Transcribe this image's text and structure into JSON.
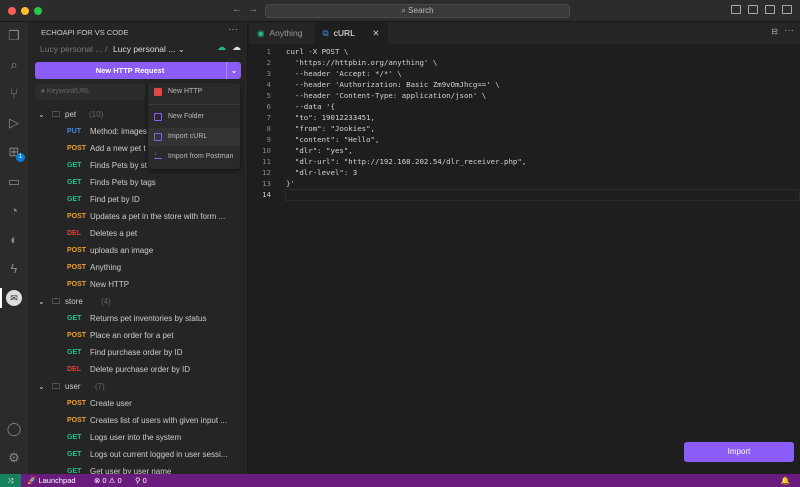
{
  "titlebar": {
    "search": "Search"
  },
  "sidebar": {
    "title": "ECHOAPI FOR VS CODE",
    "workspace": "Lucy personal ...",
    "project": "Lucy personal ...",
    "new_request": "New HTTP Request",
    "search_placeholder": "Keyword/URL",
    "folders": [
      {
        "name": "pet",
        "count": "(10)",
        "items": [
          [
            "PUT",
            "Method: images"
          ],
          [
            "POST",
            "Add a new pet t"
          ],
          [
            "GET",
            "Finds Pets by st"
          ],
          [
            "GET",
            "Finds Pets by tags"
          ],
          [
            "GET",
            "Find pet by ID"
          ],
          [
            "POST",
            "Updates a pet in the store with form ..."
          ],
          [
            "DEL",
            "Deletes a pet"
          ],
          [
            "POST",
            "uploads an image"
          ],
          [
            "POST",
            "Anything"
          ],
          [
            "POST",
            "New HTTP"
          ]
        ]
      },
      {
        "name": "store",
        "count": "(4)",
        "items": [
          [
            "GET",
            "Returns pet inventories by status"
          ],
          [
            "POST",
            "Place an order for a pet"
          ],
          [
            "GET",
            "Find purchase order by ID"
          ],
          [
            "DEL",
            "Delete purchase order by ID"
          ]
        ]
      },
      {
        "name": "user",
        "count": "(7)",
        "items": [
          [
            "POST",
            "Create user"
          ],
          [
            "POST",
            "Creates list of users with given input ..."
          ],
          [
            "GET",
            "Logs user into the system"
          ],
          [
            "GET",
            "Logs out current logged in user sessi..."
          ],
          [
            "GET",
            "Get user by user name"
          ]
        ]
      }
    ]
  },
  "menu": {
    "items": [
      "New HTTP",
      "New Folder",
      "Import cURL",
      "Import from Postman"
    ]
  },
  "tabs": [
    {
      "label": "Anything"
    },
    {
      "label": "cURL"
    }
  ],
  "code": [
    "curl -X POST \\",
    "  'https://httpbin.org/anything' \\",
    "  --header 'Accept: */*' \\",
    "  --header 'Authorization: Basic Zm9vOmJhcg==' \\",
    "  --header 'Content-Type: application/json' \\",
    "  --data '{",
    "  \"to\": 19012233451,",
    "  \"from\": \"Jookies\",",
    "  \"content\": \"Hello\",",
    "  \"dlr\": \"yes\",",
    "  \"dlr-url\": \"http://192.168.202.54/dlr_receiver.php\",",
    "  \"dlr-level\": 3",
    "}'",
    ""
  ],
  "import_label": "Import",
  "status": {
    "launchpad": "Launchpad",
    "errors": "0",
    "warnings": "0",
    "ports": "0"
  },
  "badge": "1",
  "colors": {
    "accent": "#8b5cf6",
    "status": "#6a1b7e"
  }
}
